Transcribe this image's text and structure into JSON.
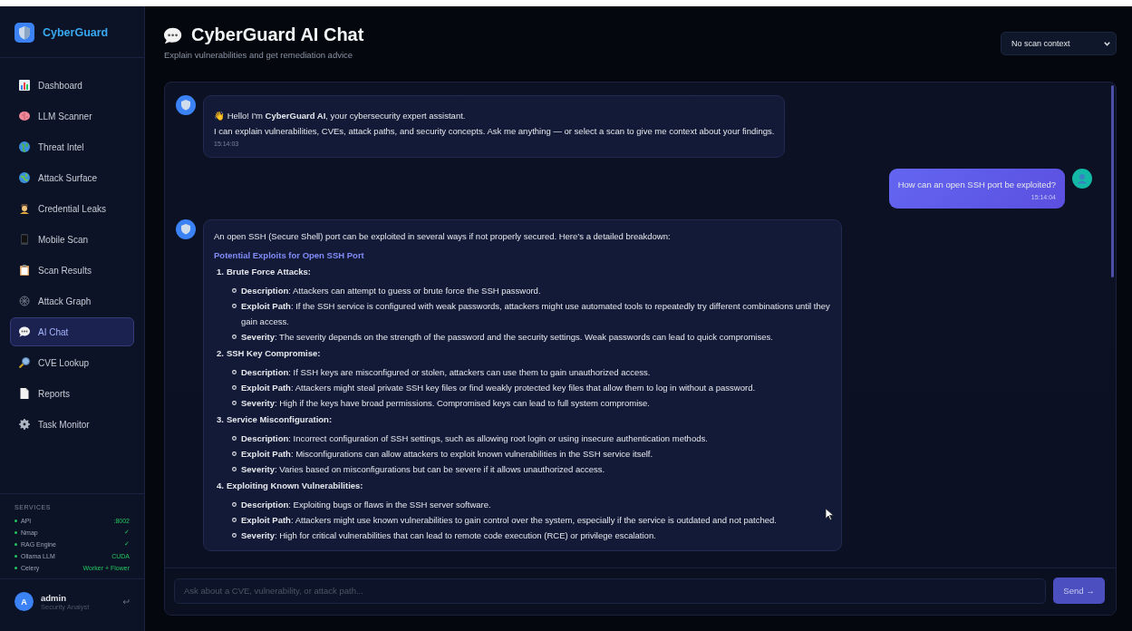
{
  "sidebar": {
    "brand": "CyberGuard",
    "items": [
      {
        "label": "Dashboard",
        "selected": false
      },
      {
        "label": "LLM Scanner",
        "selected": false
      },
      {
        "label": "Threat Intel",
        "selected": false
      },
      {
        "label": "Attack Surface",
        "selected": false
      },
      {
        "label": "Credential Leaks",
        "selected": false
      },
      {
        "label": "Mobile Scan",
        "selected": false
      },
      {
        "label": "Scan Results",
        "selected": false
      },
      {
        "label": "Attack Graph",
        "selected": false
      },
      {
        "label": "AI Chat",
        "selected": true
      },
      {
        "label": "CVE Lookup",
        "selected": false
      },
      {
        "label": "Reports",
        "selected": false
      },
      {
        "label": "Task Monitor",
        "selected": false
      }
    ],
    "services_title": "SERVICES",
    "services": [
      {
        "name": "API",
        "value": ":8002"
      },
      {
        "name": "Nmap",
        "value": "✓"
      },
      {
        "name": "RAG Engine",
        "value": "✓"
      },
      {
        "name": "Ollama LLM",
        "value": "CUDA"
      },
      {
        "name": "Celery",
        "value": "Worker + Flower"
      }
    ],
    "user": {
      "initial": "A",
      "name": "admin",
      "role": "Security Analyst"
    }
  },
  "header": {
    "title": "CyberGuard AI Chat",
    "subtitle": "Explain vulnerabilities and get remediation advice",
    "context_select": "No scan context"
  },
  "messages": [
    {
      "kind": "assistant",
      "paragraphs": [
        "👋 Hello! I'm **CyberGuard AI**, your cybersecurity expert assistant.",
        "I can explain vulnerabilities, CVEs, attack paths, and security concepts. Ask me anything — or select a scan to give me context about your findings."
      ],
      "time": "15:14:03"
    },
    {
      "kind": "user",
      "text": "How can an open SSH port be exploited?",
      "time": "15:14:04"
    },
    {
      "kind": "answer",
      "intro": "An open SSH (Secure Shell) port can be exploited in several ways if not properly secured. Here’s a detailed breakdown:",
      "heading": "Potential Exploits for Open SSH Port",
      "sections": [
        {
          "number": "1.",
          "title": "Brute Force Attacks:",
          "bullets": [
            "**Description**: Attackers can attempt to guess or brute force the SSH password.",
            "**Exploit Path**: If the SSH service is configured with weak passwords, attackers might use automated tools to repeatedly try different combinations until they gain access.",
            "**Severity**: The severity depends on the strength of the password and the security settings. Weak passwords can lead to quick compromises."
          ]
        },
        {
          "number": "2.",
          "title": "SSH Key Compromise:",
          "bullets": [
            "**Description**: If SSH keys are misconfigured or stolen, attackers can use them to gain unauthorized access.",
            "**Exploit Path**: Attackers might steal private SSH key files or find weakly protected key files that allow them to log in without a password.",
            "**Severity**: High if the keys have broad permissions. Compromised keys can lead to full system compromise."
          ]
        },
        {
          "number": "3.",
          "title": "Service Misconfiguration:",
          "bullets": [
            "**Description**: Incorrect configuration of SSH settings, such as allowing root login or using insecure authentication methods.",
            "**Exploit Path**: Misconfigurations can allow attackers to exploit known vulnerabilities in the SSH service itself.",
            "**Severity**: Varies based on misconfigurations but can be severe if it allows unauthorized access."
          ]
        },
        {
          "number": "4.",
          "title": "Exploiting Known Vulnerabilities:",
          "bullets": [
            "**Description**: Exploiting bugs or flaws in the SSH server software.",
            "**Exploit Path**: Attackers might use known vulnerabilities to gain control over the system, especially if the service is outdated and not patched.",
            "**Severity**: High for critical vulnerabilities that can lead to remote code execution (RCE) or privilege escalation."
          ]
        }
      ]
    }
  ],
  "composer": {
    "placeholder": "Ask about a CVE, vulnerability, or attack path...",
    "send": "Send →"
  }
}
